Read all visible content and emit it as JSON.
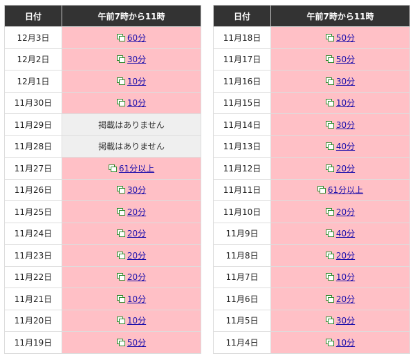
{
  "header": {
    "date_label": "日付",
    "time_label": "午前7時から11時"
  },
  "accent": {
    "link": "#1a0dab",
    "row_bg": "#ffc0c6",
    "none_bg": "#efefef",
    "header_bg": "#333333",
    "icon": "#2e8b2e"
  },
  "icon_name": "copy-icon",
  "left_table": [
    {
      "date": "12月3日",
      "value": "60分"
    },
    {
      "date": "12月2日",
      "value": "30分"
    },
    {
      "date": "12月1日",
      "value": "10分"
    },
    {
      "date": "11月30日",
      "value": "10分"
    },
    {
      "date": "11月29日",
      "value": "掲載はありません"
    },
    {
      "date": "11月28日",
      "value": "掲載はありません"
    },
    {
      "date": "11月27日",
      "value": "61分以上"
    },
    {
      "date": "11月26日",
      "value": "30分"
    },
    {
      "date": "11月25日",
      "value": "20分"
    },
    {
      "date": "11月24日",
      "value": "20分"
    },
    {
      "date": "11月23日",
      "value": "20分"
    },
    {
      "date": "11月22日",
      "value": "20分"
    },
    {
      "date": "11月21日",
      "value": "10分"
    },
    {
      "date": "11月20日",
      "value": "10分"
    },
    {
      "date": "11月19日",
      "value": "50分"
    }
  ],
  "right_table": [
    {
      "date": "11月18日",
      "value": "50分"
    },
    {
      "date": "11月17日",
      "value": "50分"
    },
    {
      "date": "11月16日",
      "value": "30分"
    },
    {
      "date": "11月15日",
      "value": "10分"
    },
    {
      "date": "11月14日",
      "value": "30分"
    },
    {
      "date": "11月13日",
      "value": "40分"
    },
    {
      "date": "11月12日",
      "value": "20分"
    },
    {
      "date": "11月11日",
      "value": "61分以上"
    },
    {
      "date": "11月10日",
      "value": "20分"
    },
    {
      "date": "11月9日",
      "value": "40分"
    },
    {
      "date": "11月8日",
      "value": "20分"
    },
    {
      "date": "11月7日",
      "value": "10分"
    },
    {
      "date": "11月6日",
      "value": "20分"
    },
    {
      "date": "11月5日",
      "value": "30分"
    },
    {
      "date": "11月4日",
      "value": "10分"
    }
  ]
}
